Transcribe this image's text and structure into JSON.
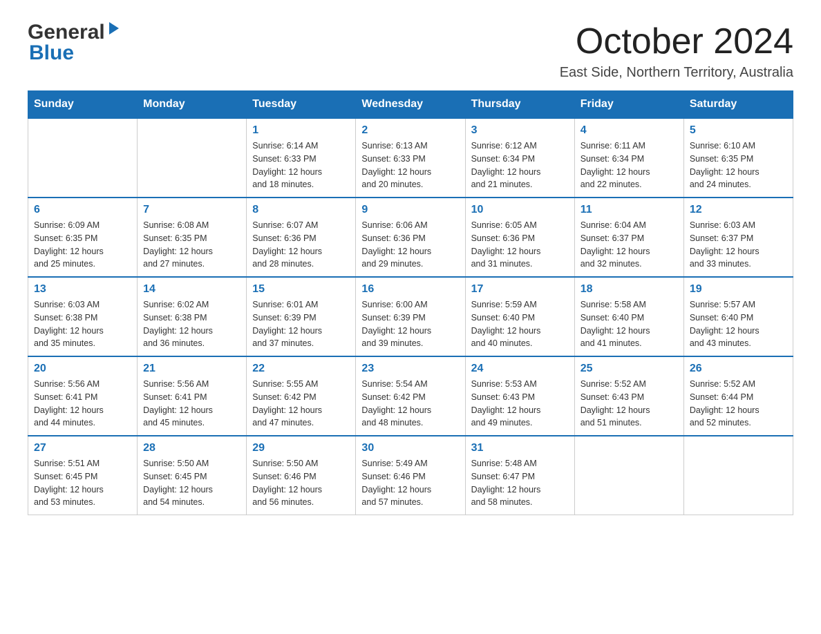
{
  "logo": {
    "general": "General",
    "blue": "Blue"
  },
  "header": {
    "month": "October 2024",
    "location": "East Side, Northern Territory, Australia"
  },
  "days_of_week": [
    "Sunday",
    "Monday",
    "Tuesday",
    "Wednesday",
    "Thursday",
    "Friday",
    "Saturday"
  ],
  "weeks": [
    [
      {
        "day": "",
        "info": ""
      },
      {
        "day": "",
        "info": ""
      },
      {
        "day": "1",
        "info": "Sunrise: 6:14 AM\nSunset: 6:33 PM\nDaylight: 12 hours\nand 18 minutes."
      },
      {
        "day": "2",
        "info": "Sunrise: 6:13 AM\nSunset: 6:33 PM\nDaylight: 12 hours\nand 20 minutes."
      },
      {
        "day": "3",
        "info": "Sunrise: 6:12 AM\nSunset: 6:34 PM\nDaylight: 12 hours\nand 21 minutes."
      },
      {
        "day": "4",
        "info": "Sunrise: 6:11 AM\nSunset: 6:34 PM\nDaylight: 12 hours\nand 22 minutes."
      },
      {
        "day": "5",
        "info": "Sunrise: 6:10 AM\nSunset: 6:35 PM\nDaylight: 12 hours\nand 24 minutes."
      }
    ],
    [
      {
        "day": "6",
        "info": "Sunrise: 6:09 AM\nSunset: 6:35 PM\nDaylight: 12 hours\nand 25 minutes."
      },
      {
        "day": "7",
        "info": "Sunrise: 6:08 AM\nSunset: 6:35 PM\nDaylight: 12 hours\nand 27 minutes."
      },
      {
        "day": "8",
        "info": "Sunrise: 6:07 AM\nSunset: 6:36 PM\nDaylight: 12 hours\nand 28 minutes."
      },
      {
        "day": "9",
        "info": "Sunrise: 6:06 AM\nSunset: 6:36 PM\nDaylight: 12 hours\nand 29 minutes."
      },
      {
        "day": "10",
        "info": "Sunrise: 6:05 AM\nSunset: 6:36 PM\nDaylight: 12 hours\nand 31 minutes."
      },
      {
        "day": "11",
        "info": "Sunrise: 6:04 AM\nSunset: 6:37 PM\nDaylight: 12 hours\nand 32 minutes."
      },
      {
        "day": "12",
        "info": "Sunrise: 6:03 AM\nSunset: 6:37 PM\nDaylight: 12 hours\nand 33 minutes."
      }
    ],
    [
      {
        "day": "13",
        "info": "Sunrise: 6:03 AM\nSunset: 6:38 PM\nDaylight: 12 hours\nand 35 minutes."
      },
      {
        "day": "14",
        "info": "Sunrise: 6:02 AM\nSunset: 6:38 PM\nDaylight: 12 hours\nand 36 minutes."
      },
      {
        "day": "15",
        "info": "Sunrise: 6:01 AM\nSunset: 6:39 PM\nDaylight: 12 hours\nand 37 minutes."
      },
      {
        "day": "16",
        "info": "Sunrise: 6:00 AM\nSunset: 6:39 PM\nDaylight: 12 hours\nand 39 minutes."
      },
      {
        "day": "17",
        "info": "Sunrise: 5:59 AM\nSunset: 6:40 PM\nDaylight: 12 hours\nand 40 minutes."
      },
      {
        "day": "18",
        "info": "Sunrise: 5:58 AM\nSunset: 6:40 PM\nDaylight: 12 hours\nand 41 minutes."
      },
      {
        "day": "19",
        "info": "Sunrise: 5:57 AM\nSunset: 6:40 PM\nDaylight: 12 hours\nand 43 minutes."
      }
    ],
    [
      {
        "day": "20",
        "info": "Sunrise: 5:56 AM\nSunset: 6:41 PM\nDaylight: 12 hours\nand 44 minutes."
      },
      {
        "day": "21",
        "info": "Sunrise: 5:56 AM\nSunset: 6:41 PM\nDaylight: 12 hours\nand 45 minutes."
      },
      {
        "day": "22",
        "info": "Sunrise: 5:55 AM\nSunset: 6:42 PM\nDaylight: 12 hours\nand 47 minutes."
      },
      {
        "day": "23",
        "info": "Sunrise: 5:54 AM\nSunset: 6:42 PM\nDaylight: 12 hours\nand 48 minutes."
      },
      {
        "day": "24",
        "info": "Sunrise: 5:53 AM\nSunset: 6:43 PM\nDaylight: 12 hours\nand 49 minutes."
      },
      {
        "day": "25",
        "info": "Sunrise: 5:52 AM\nSunset: 6:43 PM\nDaylight: 12 hours\nand 51 minutes."
      },
      {
        "day": "26",
        "info": "Sunrise: 5:52 AM\nSunset: 6:44 PM\nDaylight: 12 hours\nand 52 minutes."
      }
    ],
    [
      {
        "day": "27",
        "info": "Sunrise: 5:51 AM\nSunset: 6:45 PM\nDaylight: 12 hours\nand 53 minutes."
      },
      {
        "day": "28",
        "info": "Sunrise: 5:50 AM\nSunset: 6:45 PM\nDaylight: 12 hours\nand 54 minutes."
      },
      {
        "day": "29",
        "info": "Sunrise: 5:50 AM\nSunset: 6:46 PM\nDaylight: 12 hours\nand 56 minutes."
      },
      {
        "day": "30",
        "info": "Sunrise: 5:49 AM\nSunset: 6:46 PM\nDaylight: 12 hours\nand 57 minutes."
      },
      {
        "day": "31",
        "info": "Sunrise: 5:48 AM\nSunset: 6:47 PM\nDaylight: 12 hours\nand 58 minutes."
      },
      {
        "day": "",
        "info": ""
      },
      {
        "day": "",
        "info": ""
      }
    ]
  ]
}
